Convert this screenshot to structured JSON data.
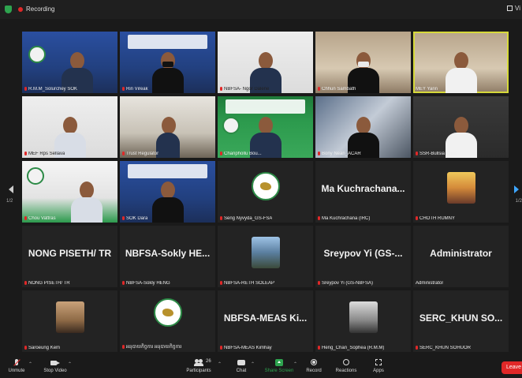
{
  "topbar": {
    "recording_label": "Recording",
    "view_label": "Vi"
  },
  "pagination": {
    "left_page": "1/2",
    "right_page": "1/2"
  },
  "participants": [
    {
      "name": "R.M.M_Solurchey SOK"
    },
    {
      "name": "Rin Vireak"
    },
    {
      "name": "NBFSA- Ngor Dalene"
    },
    {
      "name": "Chhun Sambath"
    },
    {
      "name": "MEY Yann"
    },
    {
      "name": "MEF Rps Sellava"
    },
    {
      "name": "Trust Regulator"
    },
    {
      "name": "Chanphollu Bou..."
    },
    {
      "name": "Bony Nean_ACAR"
    },
    {
      "name": "SSR-Bullsia Chea"
    },
    {
      "name": "Chou Vattras"
    },
    {
      "name": "SOK Dara"
    },
    {
      "name": "Seng Nyvyda_GS-FSA"
    },
    {
      "name": "Ma Kuchrachana (IRC)",
      "display": "Ma Kuchrachana..."
    },
    {
      "name": "CHOTH RUMNY"
    },
    {
      "name": "NONG PISETH/ TR",
      "display": "NONG PISETH/ TR"
    },
    {
      "name": "NBFSA-Sokly HENG",
      "display": "NBFSA-Sokly HE..."
    },
    {
      "name": "NBFSA-RETH SOLEAP"
    },
    {
      "name": "Sreypov Yi (GS-NBFSA)",
      "display": "Sreypov Yi (GS-..."
    },
    {
      "name": "Administrator",
      "display": "Administrator"
    },
    {
      "name": "Saroeung Kem"
    },
    {
      "name": "អនុបាយកិច្ចការ អនុបាយកិច្ចការ"
    },
    {
      "name": "NBFSA-MEAS Kimhay",
      "display": "NBFSA-MEAS Ki..."
    },
    {
      "name": "Heng_Chan_Sophea (R.M.M)"
    },
    {
      "name": "SERC_KHUN SOHUOR",
      "display": "SERC_KHUN SO..."
    }
  ],
  "toolbar": {
    "unmute": "Unmute",
    "stop_video": "Stop Video",
    "participants": "Participants",
    "participant_count": "26",
    "chat": "Chat",
    "share_screen": "Share Screen",
    "record": "Record",
    "reactions": "Reactions",
    "apps": "Apps",
    "leave": "Leave"
  },
  "colors": {
    "active_speaker": "#d6d93a",
    "share_green": "#2ea44f",
    "leave_red": "#e02828",
    "muted_red": "#e02828"
  }
}
